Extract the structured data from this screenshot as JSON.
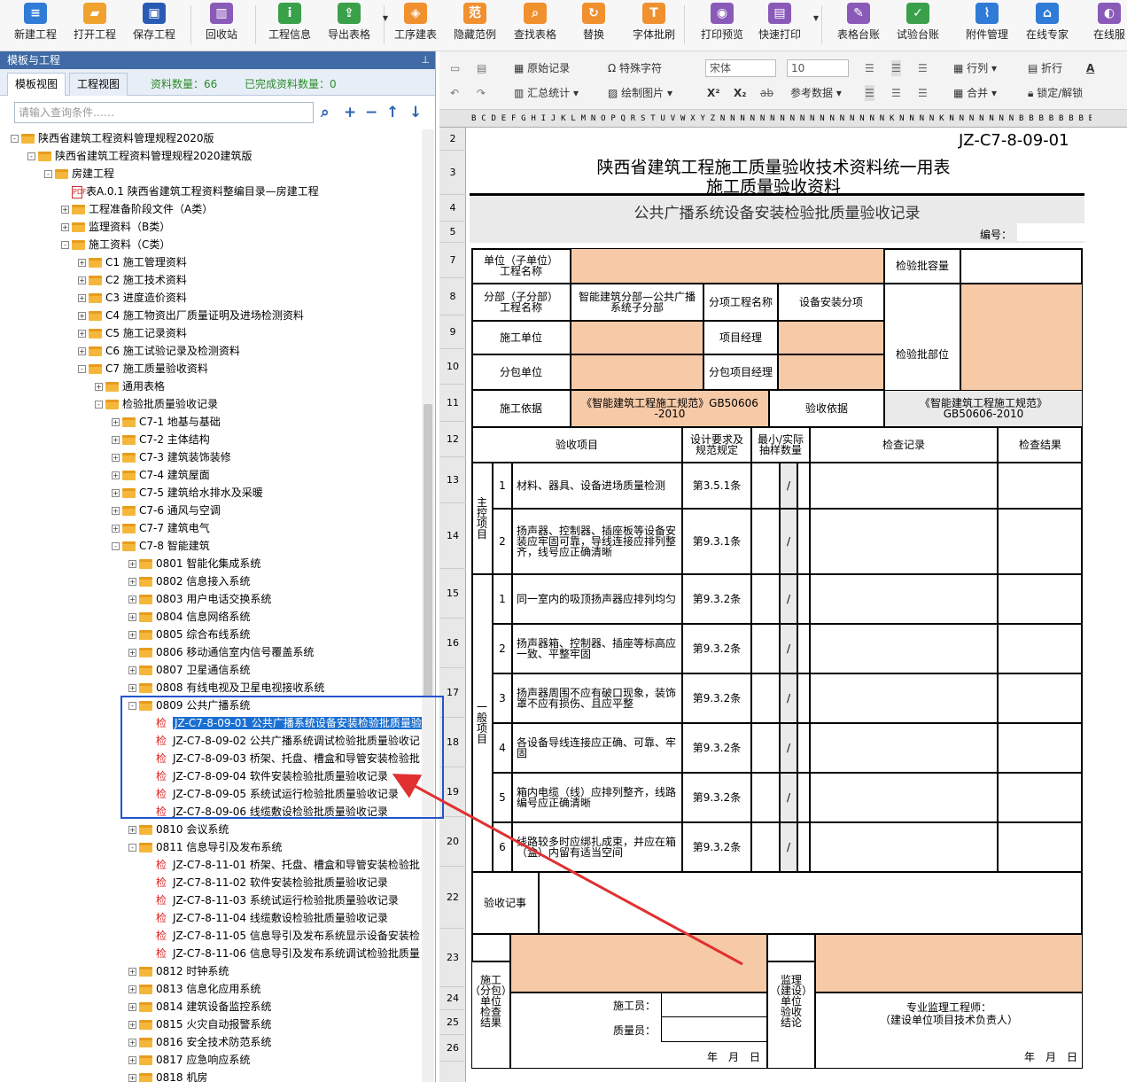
{
  "toolbar": [
    {
      "label": "新建工程",
      "icon": "new-doc-icon",
      "color": "#2f7bd6",
      "glyph": "≡"
    },
    {
      "label": "打开工程",
      "icon": "open-folder-icon",
      "color": "#f0a22e",
      "glyph": "▰"
    },
    {
      "label": "保存工程",
      "icon": "save-icon",
      "color": "#2a5bb4",
      "glyph": "▣"
    },
    {
      "label": "回收站",
      "icon": "trash-icon",
      "color": "#8a5ab8",
      "glyph": "▥"
    },
    {
      "label": "工程信息",
      "icon": "info-icon",
      "color": "#3aa04a",
      "glyph": "i"
    },
    {
      "label": "导出表格",
      "icon": "export-icon",
      "color": "#3aa04a",
      "glyph": "⇪"
    },
    {
      "label": "工序建表",
      "icon": "layers-icon",
      "color": "#f0902e",
      "glyph": "◈"
    },
    {
      "label": "隐藏范例",
      "icon": "sample-icon",
      "color": "#f0902e",
      "glyph": "范"
    },
    {
      "label": "查找表格",
      "icon": "search-icon",
      "color": "#f0902e",
      "glyph": "⌕"
    },
    {
      "label": "替换",
      "icon": "replace-icon",
      "color": "#f0902e",
      "glyph": "↻"
    },
    {
      "label": "字体批刷",
      "icon": "font-brush-icon",
      "color": "#f0902e",
      "glyph": "T"
    },
    {
      "label": "打印预览",
      "icon": "print-preview-icon",
      "color": "#8a5ab8",
      "glyph": "◉"
    },
    {
      "label": "快速打印",
      "icon": "print-icon",
      "color": "#8a5ab8",
      "glyph": "▤"
    },
    {
      "label": "表格台账",
      "icon": "ledger-icon",
      "color": "#8a5ab8",
      "glyph": "✎"
    },
    {
      "label": "试验台账",
      "icon": "test-ledger-icon",
      "color": "#3aa04a",
      "glyph": "✓"
    },
    {
      "label": "附件管理",
      "icon": "attachment-icon",
      "color": "#2f7bd6",
      "glyph": "⌇"
    },
    {
      "label": "在线专家",
      "icon": "expert-icon",
      "color": "#2f7bd6",
      "glyph": "⌂"
    },
    {
      "label": "在线服",
      "icon": "service-icon",
      "color": "#8a5ab8",
      "glyph": "◐"
    }
  ],
  "left_panel": {
    "title": "模板与工程",
    "tab_template": "模板视图",
    "tab_project": "工程视图",
    "count_label": "资料数量：66",
    "done_label": "已完成资料数量：0",
    "search_placeholder": "请输入查询条件……"
  },
  "tree": [
    {
      "lv": 0,
      "t": "f",
      "pm": "-",
      "label": "陕西省建筑工程资料管理规程2020版"
    },
    {
      "lv": 1,
      "t": "f",
      "pm": "-",
      "label": "陕西省建筑工程资料管理规程2020建筑版"
    },
    {
      "lv": 2,
      "t": "f",
      "pm": "-",
      "label": "房建工程"
    },
    {
      "lv": 3,
      "t": "p",
      "pm": "",
      "label": "表A.0.1 陕西省建筑工程资料整编目录—房建工程"
    },
    {
      "lv": 3,
      "t": "f",
      "pm": "+",
      "label": "工程准备阶段文件（A类）"
    },
    {
      "lv": 3,
      "t": "f",
      "pm": "+",
      "label": "监理资料（B类）"
    },
    {
      "lv": 3,
      "t": "f",
      "pm": "-",
      "label": "施工资料（C类）"
    },
    {
      "lv": 4,
      "t": "f",
      "pm": "+",
      "label": "C1 施工管理资料"
    },
    {
      "lv": 4,
      "t": "f",
      "pm": "+",
      "label": "C2 施工技术资料"
    },
    {
      "lv": 4,
      "t": "f",
      "pm": "+",
      "label": "C3 进度造价资料"
    },
    {
      "lv": 4,
      "t": "f",
      "pm": "+",
      "label": "C4 施工物资出厂质量证明及进场检测资料"
    },
    {
      "lv": 4,
      "t": "f",
      "pm": "+",
      "label": "C5 施工记录资料"
    },
    {
      "lv": 4,
      "t": "f",
      "pm": "+",
      "label": "C6 施工试验记录及检测资料"
    },
    {
      "lv": 4,
      "t": "f",
      "pm": "-",
      "label": "C7 施工质量验收资料"
    },
    {
      "lv": 5,
      "t": "f",
      "pm": "+",
      "label": "通用表格"
    },
    {
      "lv": 5,
      "t": "f",
      "pm": "-",
      "label": "检验批质量验收记录"
    },
    {
      "lv": 6,
      "t": "f",
      "pm": "+",
      "label": "C7-1 地基与基础"
    },
    {
      "lv": 6,
      "t": "f",
      "pm": "+",
      "label": "C7-2 主体结构"
    },
    {
      "lv": 6,
      "t": "f",
      "pm": "+",
      "label": "C7-3 建筑装饰装修"
    },
    {
      "lv": 6,
      "t": "f",
      "pm": "+",
      "label": "C7-4 建筑屋面"
    },
    {
      "lv": 6,
      "t": "f",
      "pm": "+",
      "label": "C7-5 建筑给水排水及采暖"
    },
    {
      "lv": 6,
      "t": "f",
      "pm": "+",
      "label": "C7-6 通风与空调"
    },
    {
      "lv": 6,
      "t": "f",
      "pm": "+",
      "label": "C7-7 建筑电气"
    },
    {
      "lv": 6,
      "t": "f",
      "pm": "-",
      "label": "C7-8 智能建筑"
    },
    {
      "lv": 7,
      "t": "f",
      "pm": "+",
      "label": "0801 智能化集成系统"
    },
    {
      "lv": 7,
      "t": "f",
      "pm": "+",
      "label": "0802 信息接入系统"
    },
    {
      "lv": 7,
      "t": "f",
      "pm": "+",
      "label": "0803 用户电话交换系统"
    },
    {
      "lv": 7,
      "t": "f",
      "pm": "+",
      "label": "0804 信息网络系统"
    },
    {
      "lv": 7,
      "t": "f",
      "pm": "+",
      "label": "0805 综合布线系统"
    },
    {
      "lv": 7,
      "t": "f",
      "pm": "+",
      "label": "0806 移动通信室内信号覆盖系统"
    },
    {
      "lv": 7,
      "t": "f",
      "pm": "+",
      "label": "0807 卫星通信系统"
    },
    {
      "lv": 7,
      "t": "f",
      "pm": "+",
      "label": "0808 有线电视及卫星电视接收系统"
    },
    {
      "lv": 7,
      "t": "f",
      "pm": "-",
      "label": "0809 公共广播系统"
    },
    {
      "lv": 8,
      "t": "c",
      "pm": "",
      "label": "JZ-C7-8-09-01 公共广播系统设备安装检验批质量验",
      "sel": true
    },
    {
      "lv": 8,
      "t": "c",
      "pm": "",
      "label": "JZ-C7-8-09-02 公共广播系统调试检验批质量验收记"
    },
    {
      "lv": 8,
      "t": "c",
      "pm": "",
      "label": "JZ-C7-8-09-03 桥架、托盘、槽盒和导管安装检验批"
    },
    {
      "lv": 8,
      "t": "c",
      "pm": "",
      "label": "JZ-C7-8-09-04 软件安装检验批质量验收记录"
    },
    {
      "lv": 8,
      "t": "c",
      "pm": "",
      "label": "JZ-C7-8-09-05 系统试运行检验批质量验收记录"
    },
    {
      "lv": 8,
      "t": "c",
      "pm": "",
      "label": "JZ-C7-8-09-06 线缆敷设检验批质量验收记录"
    },
    {
      "lv": 7,
      "t": "f",
      "pm": "+",
      "label": "0810 会议系统"
    },
    {
      "lv": 7,
      "t": "f",
      "pm": "-",
      "label": "0811 信息导引及发布系统"
    },
    {
      "lv": 8,
      "t": "c",
      "pm": "",
      "label": "JZ-C7-8-11-01 桥架、托盘、槽盒和导管安装检验批"
    },
    {
      "lv": 8,
      "t": "c",
      "pm": "",
      "label": "JZ-C7-8-11-02 软件安装检验批质量验收记录"
    },
    {
      "lv": 8,
      "t": "c",
      "pm": "",
      "label": "JZ-C7-8-11-03 系统试运行检验批质量验收记录"
    },
    {
      "lv": 8,
      "t": "c",
      "pm": "",
      "label": "JZ-C7-8-11-04 线缆敷设检验批质量验收记录"
    },
    {
      "lv": 8,
      "t": "c",
      "pm": "",
      "label": "JZ-C7-8-11-05 信息导引及发布系统显示设备安装检"
    },
    {
      "lv": 8,
      "t": "c",
      "pm": "",
      "label": "JZ-C7-8-11-06 信息导引及发布系统调试检验批质量"
    },
    {
      "lv": 7,
      "t": "f",
      "pm": "+",
      "label": "0812 时钟系统"
    },
    {
      "lv": 7,
      "t": "f",
      "pm": "+",
      "label": "0813 信息化应用系统"
    },
    {
      "lv": 7,
      "t": "f",
      "pm": "+",
      "label": "0814 建筑设备监控系统"
    },
    {
      "lv": 7,
      "t": "f",
      "pm": "+",
      "label": "0815 火灾自动报警系统"
    },
    {
      "lv": 7,
      "t": "f",
      "pm": "+",
      "label": "0816 安全技术防范系统"
    },
    {
      "lv": 7,
      "t": "f",
      "pm": "+",
      "label": "0817 应急响应系统"
    },
    {
      "lv": 7,
      "t": "f",
      "pm": "+",
      "label": "0818 机房"
    }
  ],
  "check_glyph": "检",
  "pdf_glyph": "PDF",
  "ribbon": {
    "original_record": "原始记录",
    "special_char": "特殊字符",
    "summary_stats": "汇总统计",
    "draw_picture": "绘制图片",
    "font_name": "宋体",
    "font_size": "10",
    "superscript": "X²",
    "subscript": "X₂",
    "strike": "ab",
    "ref_data": "参考数据",
    "row_col": "行列",
    "merge": "合并",
    "wrap": "折行",
    "lock": "锁定/解锁",
    "font_color": "A"
  },
  "col_letters": "B C D E F G H I J K L M N O P Q R S T U V W X Y Z N N N N N N N N N N N N N N N N N K N N N N K N N N N N N N B B B B B B B B B B B",
  "row_numbers": [
    {
      "n": "2",
      "h": 26
    },
    {
      "n": "3",
      "h": 50
    },
    {
      "n": "4",
      "h": 30
    },
    {
      "n": "5",
      "h": 24
    },
    {
      "n": "7",
      "h": 40
    },
    {
      "n": "8",
      "h": 42
    },
    {
      "n": "9",
      "h": 38
    },
    {
      "n": "10",
      "h": 40
    },
    {
      "n": "11",
      "h": 42
    },
    {
      "n": "12",
      "h": 40
    },
    {
      "n": "13",
      "h": 52
    },
    {
      "n": "14",
      "h": 74
    },
    {
      "n": "15",
      "h": 56
    },
    {
      "n": "16",
      "h": 56
    },
    {
      "n": "17",
      "h": 56
    },
    {
      "n": "18",
      "h": 56
    },
    {
      "n": "19",
      "h": 56
    },
    {
      "n": "20",
      "h": 56
    },
    {
      "n": "22",
      "h": 70
    },
    {
      "n": "23",
      "h": 66
    },
    {
      "n": "24",
      "h": 26
    },
    {
      "n": "25",
      "h": 28
    },
    {
      "n": "26",
      "h": 30
    }
  ],
  "form": {
    "code": "JZ-C7-8-09-01",
    "title1": "陕西省建筑工程施工质量验收技术资料统一用表",
    "title2": "施工质量验收资料",
    "subtitle": "公共广播系统设备安装检验批质量验收记录",
    "number_label": "编号：",
    "unit_label": "单位（子单位）\n工程名称",
    "capacity_label": "检验批容量",
    "division_label": "分部（子分部）\n工程名称",
    "division_value": "智能建筑分部—公共广播\n系统子分部",
    "item_name_label": "分项工程名称",
    "item_name_value": "设备安装分项",
    "location_label": "检验批部位",
    "constructor_label": "施工单位",
    "pm_label": "项目经理",
    "subcontractor_label": "分包单位",
    "sub_pm_label": "分包项目经理",
    "basis_label": "施工依据",
    "basis_value": "《智能建筑工程施工规范》GB50606\n-2010",
    "accept_basis_label": "验收依据",
    "accept_basis_value": "《智能建筑工程施工规范》\nGB50606-2010",
    "h_item": "验收项目",
    "h_design": "设计要求及\n规范规定",
    "h_sample": "最小/实际\n抽样数量",
    "h_record": "检查记录",
    "h_result": "检查结果",
    "main_label": "主\n控\n项\n目",
    "general_label": "一\n般\n项\n目",
    "main_items": [
      {
        "no": "1",
        "text": "材料、器具、设备进场质量检测",
        "clause": "第3.5.1条",
        "slash": "/"
      },
      {
        "no": "2",
        "text": "扬声器、控制器、插座板等设备安装应牢固可靠，导线连接应排列整齐，线号应正确清晰",
        "clause": "第9.3.1条",
        "slash": "/"
      }
    ],
    "general_items": [
      {
        "no": "1",
        "text": "同一室内的吸顶扬声器应排列均匀",
        "clause": "第9.3.2条",
        "slash": "/"
      },
      {
        "no": "2",
        "text": "扬声器箱、控制器、插座等标高应一致、平整牢固",
        "clause": "第9.3.2条",
        "slash": "/"
      },
      {
        "no": "3",
        "text": "扬声器周围不应有破口现象，装饰罩不应有损伤、且应平整",
        "clause": "第9.3.2条",
        "slash": "/"
      },
      {
        "no": "4",
        "text": "各设备导线连接应正确、可靠、牢固",
        "clause": "第9.3.2条",
        "slash": "/"
      },
      {
        "no": "5",
        "text": "箱内电缆（线）应排列整齐，线路编号应正确清晰",
        "clause": "第9.3.2条",
        "slash": "/"
      },
      {
        "no": "6",
        "text": "线路较多时应绑扎成束，并应在箱（盒）内留有适当空间",
        "clause": "第9.3.2条",
        "slash": "/"
      }
    ],
    "notes_label": "验收记事",
    "construction_conclusion": "施工\n（分包）\n单位\n检查\n结果",
    "supervision_conclusion": "监理\n（建设）\n单位\n验收\n结论",
    "builder_label": "施工员：",
    "quality_label": "质量员：",
    "supervisor_label": "专业监理工程师：\n（建设单位项目技术负责人）",
    "date1": "年　月　日",
    "date2": "年　月　日"
  }
}
